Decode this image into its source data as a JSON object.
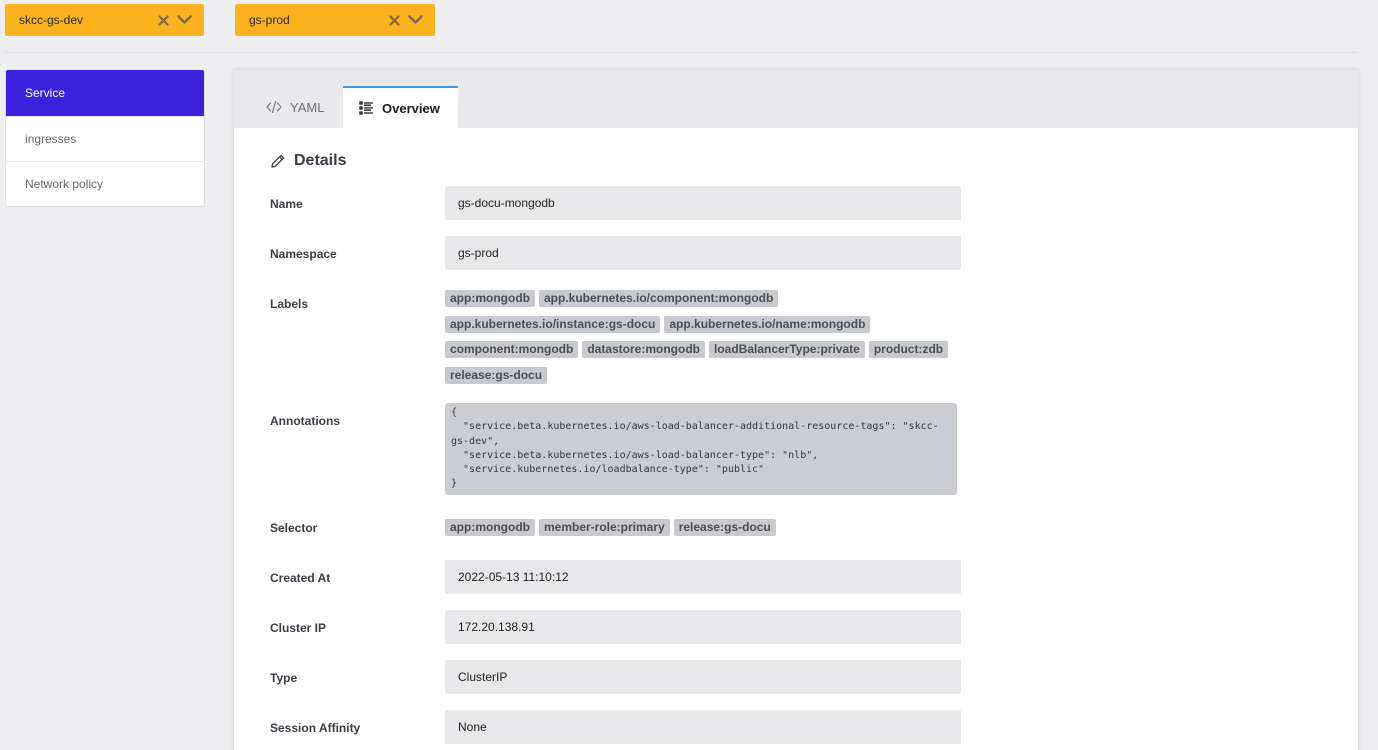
{
  "selectors": [
    {
      "value": "skcc-gs-dev"
    },
    {
      "value": "gs-prod"
    }
  ],
  "sidebar": {
    "items": [
      {
        "label": "Service",
        "active": true
      },
      {
        "label": "ingresses",
        "active": false
      },
      {
        "label": "Network policy",
        "active": false
      }
    ]
  },
  "tabs": [
    {
      "label": "YAML",
      "icon": "code-icon"
    },
    {
      "label": "Overview",
      "icon": "list-icon",
      "active": true
    }
  ],
  "details": {
    "title": "Details",
    "name_label": "Name",
    "name_value": "gs-docu-mongodb",
    "namespace_label": "Namespace",
    "namespace_value": "gs-prod",
    "labels_label": "Labels",
    "labels": [
      [
        "app:mongodb",
        "app.kubernetes.io/component:mongodb"
      ],
      [
        "app.kubernetes.io/instance:gs-docu",
        "app.kubernetes.io/name:mongodb"
      ],
      [
        "component:mongodb",
        "datastore:mongodb",
        "loadBalancerType:private",
        "product:zdb"
      ],
      [
        "release:gs-docu"
      ]
    ],
    "annotations_label": "Annotations",
    "annotations_text": "{\n  \"service.beta.kubernetes.io/aws-load-balancer-additional-resource-tags\": \"skcc-\ngs-dev\",\n  \"service.beta.kubernetes.io/aws-load-balancer-type\": \"nlb\",\n  \"service.kubernetes.io/loadbalance-type\": \"public\"\n}",
    "selector_label": "Selector",
    "selector_tags": [
      "app:mongodb",
      "member-role:primary",
      "release:gs-docu"
    ],
    "created_label": "Created At",
    "created_value": "2022-05-13 11:10:12",
    "clusterip_label": "Cluster IP",
    "clusterip_value": "172.20.138.91",
    "type_label": "Type",
    "type_value": "ClusterIP",
    "affinity_label": "Session Affinity",
    "affinity_value": "None"
  },
  "colors": {
    "selector_bg": "#fbb21f",
    "sidebar_active": "#3b22dc",
    "tab_accent": "#3b9af0"
  }
}
